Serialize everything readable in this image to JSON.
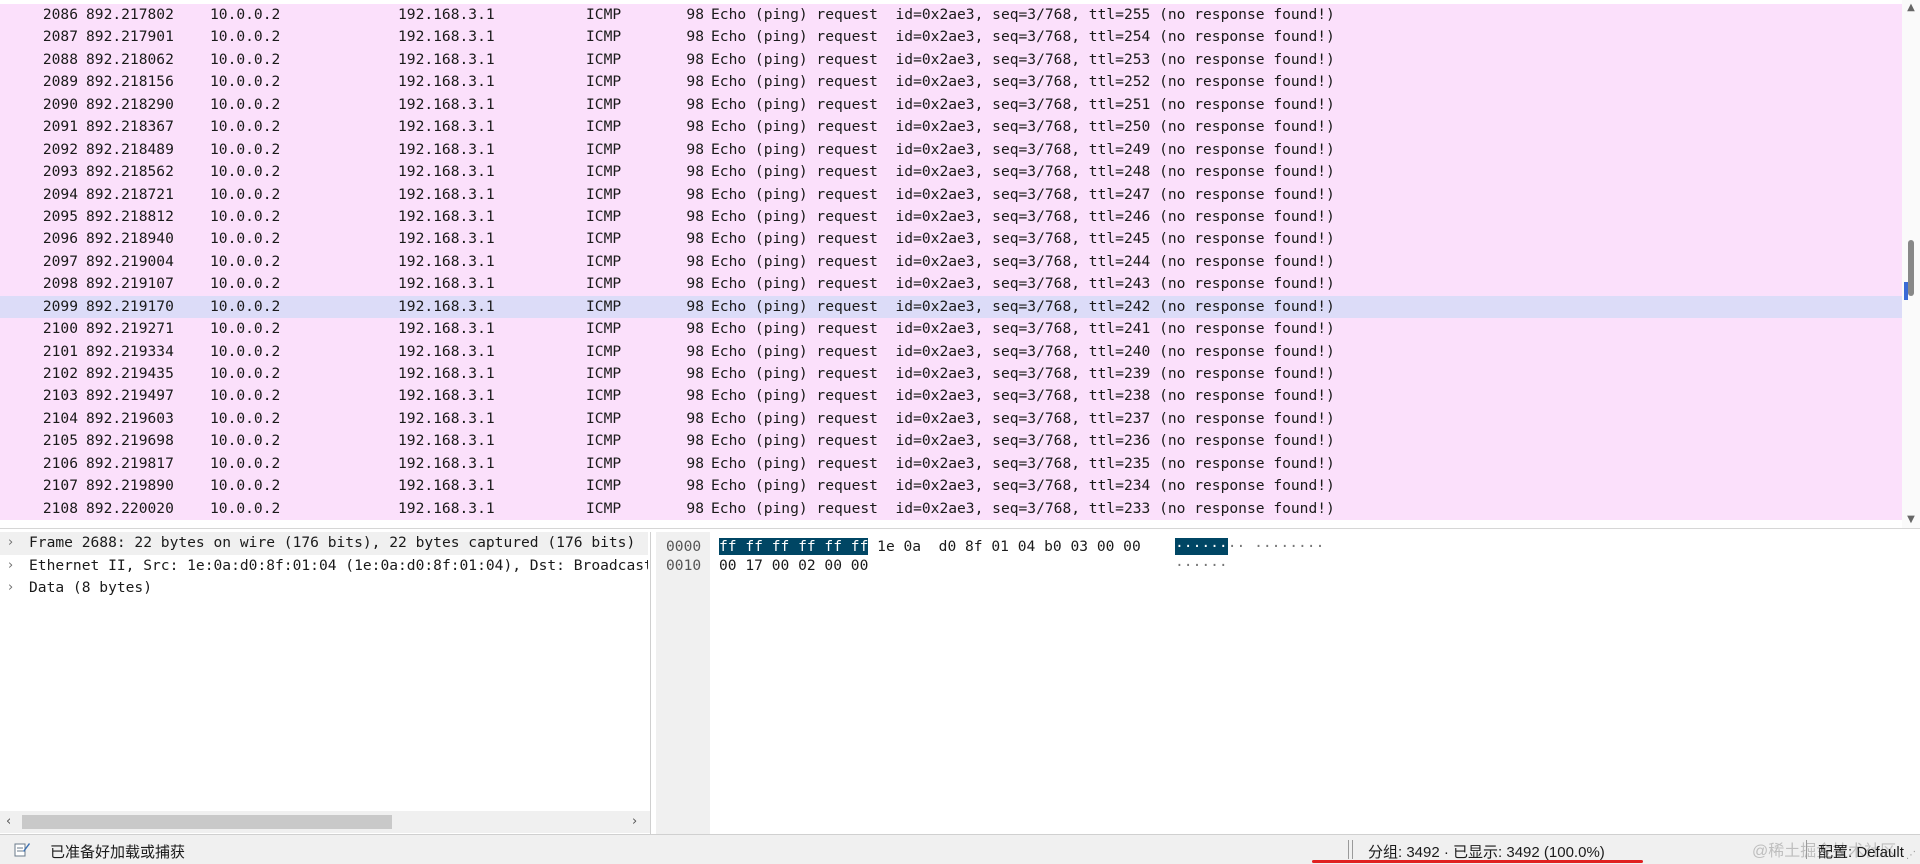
{
  "colors": {
    "row_bg": "#fbe0fb",
    "row_selected_bg": "#dcdcf8",
    "hex_highlight": "#004664",
    "status_underline": "#e02020"
  },
  "packets": [
    {
      "no": "2086",
      "time": "892.217802",
      "src": "10.0.0.2",
      "dst": "192.168.3.1",
      "proto": "ICMP",
      "len": "98",
      "info": "Echo (ping) request  id=0x2ae3, seq=3/768, ttl=255 (no response found!)"
    },
    {
      "no": "2087",
      "time": "892.217901",
      "src": "10.0.0.2",
      "dst": "192.168.3.1",
      "proto": "ICMP",
      "len": "98",
      "info": "Echo (ping) request  id=0x2ae3, seq=3/768, ttl=254 (no response found!)"
    },
    {
      "no": "2088",
      "time": "892.218062",
      "src": "10.0.0.2",
      "dst": "192.168.3.1",
      "proto": "ICMP",
      "len": "98",
      "info": "Echo (ping) request  id=0x2ae3, seq=3/768, ttl=253 (no response found!)"
    },
    {
      "no": "2089",
      "time": "892.218156",
      "src": "10.0.0.2",
      "dst": "192.168.3.1",
      "proto": "ICMP",
      "len": "98",
      "info": "Echo (ping) request  id=0x2ae3, seq=3/768, ttl=252 (no response found!)"
    },
    {
      "no": "2090",
      "time": "892.218290",
      "src": "10.0.0.2",
      "dst": "192.168.3.1",
      "proto": "ICMP",
      "len": "98",
      "info": "Echo (ping) request  id=0x2ae3, seq=3/768, ttl=251 (no response found!)"
    },
    {
      "no": "2091",
      "time": "892.218367",
      "src": "10.0.0.2",
      "dst": "192.168.3.1",
      "proto": "ICMP",
      "len": "98",
      "info": "Echo (ping) request  id=0x2ae3, seq=3/768, ttl=250 (no response found!)"
    },
    {
      "no": "2092",
      "time": "892.218489",
      "src": "10.0.0.2",
      "dst": "192.168.3.1",
      "proto": "ICMP",
      "len": "98",
      "info": "Echo (ping) request  id=0x2ae3, seq=3/768, ttl=249 (no response found!)"
    },
    {
      "no": "2093",
      "time": "892.218562",
      "src": "10.0.0.2",
      "dst": "192.168.3.1",
      "proto": "ICMP",
      "len": "98",
      "info": "Echo (ping) request  id=0x2ae3, seq=3/768, ttl=248 (no response found!)"
    },
    {
      "no": "2094",
      "time": "892.218721",
      "src": "10.0.0.2",
      "dst": "192.168.3.1",
      "proto": "ICMP",
      "len": "98",
      "info": "Echo (ping) request  id=0x2ae3, seq=3/768, ttl=247 (no response found!)"
    },
    {
      "no": "2095",
      "time": "892.218812",
      "src": "10.0.0.2",
      "dst": "192.168.3.1",
      "proto": "ICMP",
      "len": "98",
      "info": "Echo (ping) request  id=0x2ae3, seq=3/768, ttl=246 (no response found!)"
    },
    {
      "no": "2096",
      "time": "892.218940",
      "src": "10.0.0.2",
      "dst": "192.168.3.1",
      "proto": "ICMP",
      "len": "98",
      "info": "Echo (ping) request  id=0x2ae3, seq=3/768, ttl=245 (no response found!)"
    },
    {
      "no": "2097",
      "time": "892.219004",
      "src": "10.0.0.2",
      "dst": "192.168.3.1",
      "proto": "ICMP",
      "len": "98",
      "info": "Echo (ping) request  id=0x2ae3, seq=3/768, ttl=244 (no response found!)"
    },
    {
      "no": "2098",
      "time": "892.219107",
      "src": "10.0.0.2",
      "dst": "192.168.3.1",
      "proto": "ICMP",
      "len": "98",
      "info": "Echo (ping) request  id=0x2ae3, seq=3/768, ttl=243 (no response found!)"
    },
    {
      "no": "2099",
      "time": "892.219170",
      "src": "10.0.0.2",
      "dst": "192.168.3.1",
      "proto": "ICMP",
      "len": "98",
      "info": "Echo (ping) request  id=0x2ae3, seq=3/768, ttl=242 (no response found!)",
      "selected": true
    },
    {
      "no": "2100",
      "time": "892.219271",
      "src": "10.0.0.2",
      "dst": "192.168.3.1",
      "proto": "ICMP",
      "len": "98",
      "info": "Echo (ping) request  id=0x2ae3, seq=3/768, ttl=241 (no response found!)"
    },
    {
      "no": "2101",
      "time": "892.219334",
      "src": "10.0.0.2",
      "dst": "192.168.3.1",
      "proto": "ICMP",
      "len": "98",
      "info": "Echo (ping) request  id=0x2ae3, seq=3/768, ttl=240 (no response found!)"
    },
    {
      "no": "2102",
      "time": "892.219435",
      "src": "10.0.0.2",
      "dst": "192.168.3.1",
      "proto": "ICMP",
      "len": "98",
      "info": "Echo (ping) request  id=0x2ae3, seq=3/768, ttl=239 (no response found!)"
    },
    {
      "no": "2103",
      "time": "892.219497",
      "src": "10.0.0.2",
      "dst": "192.168.3.1",
      "proto": "ICMP",
      "len": "98",
      "info": "Echo (ping) request  id=0x2ae3, seq=3/768, ttl=238 (no response found!)"
    },
    {
      "no": "2104",
      "time": "892.219603",
      "src": "10.0.0.2",
      "dst": "192.168.3.1",
      "proto": "ICMP",
      "len": "98",
      "info": "Echo (ping) request  id=0x2ae3, seq=3/768, ttl=237 (no response found!)"
    },
    {
      "no": "2105",
      "time": "892.219698",
      "src": "10.0.0.2",
      "dst": "192.168.3.1",
      "proto": "ICMP",
      "len": "98",
      "info": "Echo (ping) request  id=0x2ae3, seq=3/768, ttl=236 (no response found!)"
    },
    {
      "no": "2106",
      "time": "892.219817",
      "src": "10.0.0.2",
      "dst": "192.168.3.1",
      "proto": "ICMP",
      "len": "98",
      "info": "Echo (ping) request  id=0x2ae3, seq=3/768, ttl=235 (no response found!)"
    },
    {
      "no": "2107",
      "time": "892.219890",
      "src": "10.0.0.2",
      "dst": "192.168.3.1",
      "proto": "ICMP",
      "len": "98",
      "info": "Echo (ping) request  id=0x2ae3, seq=3/768, ttl=234 (no response found!)"
    },
    {
      "no": "2108",
      "time": "892.220020",
      "src": "10.0.0.2",
      "dst": "192.168.3.1",
      "proto": "ICMP",
      "len": "98",
      "info": "Echo (ping) request  id=0x2ae3, seq=3/768, ttl=233 (no response found!)"
    }
  ],
  "details": [
    {
      "arrow": "›",
      "text": "Frame 2688: 22 bytes on wire (176 bits), 22 bytes captured (176 bits)"
    },
    {
      "arrow": "›",
      "text": "Ethernet II, Src: 1e:0a:d0:8f:01:04 (1e:0a:d0:8f:01:04), Dst: Broadcast (ff:ff:ff:ff:ff:ff)"
    },
    {
      "arrow": "›",
      "text": "Data (8 bytes)"
    }
  ],
  "bytes": [
    {
      "offset": "0000",
      "hex_hl": "ff ff ff ff ff ff",
      "hex_rest": " 1e 0a  d0 8f 01 04 b0 03 00 00",
      "ascii_hl": "······",
      "ascii_rest": "·· ········"
    },
    {
      "offset": "0010",
      "hex_hl": "",
      "hex_rest": "00 17 00 02 00 00",
      "ascii_hl": "",
      "ascii_rest": "······"
    }
  ],
  "status": {
    "ready": "已准备好加载或捕获",
    "counts": "分组: 3492 · 已显示: 3492 (100.0%)",
    "profile": "配置: Default",
    "watermark": "@稀土掘金技术社区"
  },
  "icons": {
    "status_edit": "edit-capture-comment-icon",
    "expand": "chevron-right-icon",
    "scroll_up": "▲",
    "scroll_down": "▼",
    "scroll_left": "‹",
    "scroll_right": "›"
  }
}
